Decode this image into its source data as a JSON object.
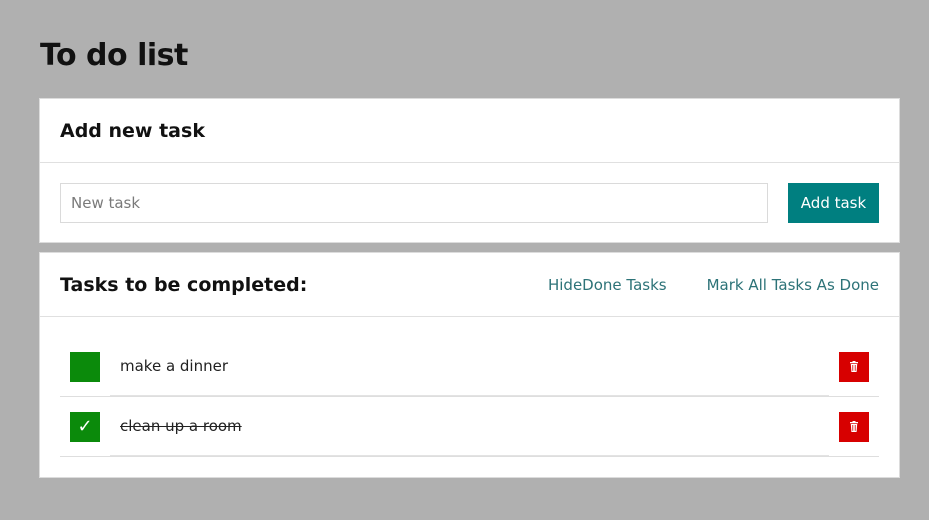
{
  "page": {
    "title": "To do list"
  },
  "new_task": {
    "header": "Add new task",
    "input_placeholder": "New task",
    "input_value": "",
    "add_button": "Add task"
  },
  "tasks_section": {
    "header": "Tasks to be completed:",
    "hide_done_button": "HideDone Tasks",
    "mark_all_done_button": "Mark All Tasks As Done",
    "tasks": [
      {
        "content": "make a dinner",
        "done": false,
        "toggle_icon": "",
        "remove_icon": "trash-icon"
      },
      {
        "content": "clean up a room",
        "done": true,
        "toggle_icon": "✓",
        "remove_icon": "trash-icon"
      }
    ]
  },
  "colors": {
    "background": "#b0b0b0",
    "accent": "#007f80",
    "link": "#2d7378",
    "toggle": "#0b8a0b",
    "remove": "#d70000"
  }
}
